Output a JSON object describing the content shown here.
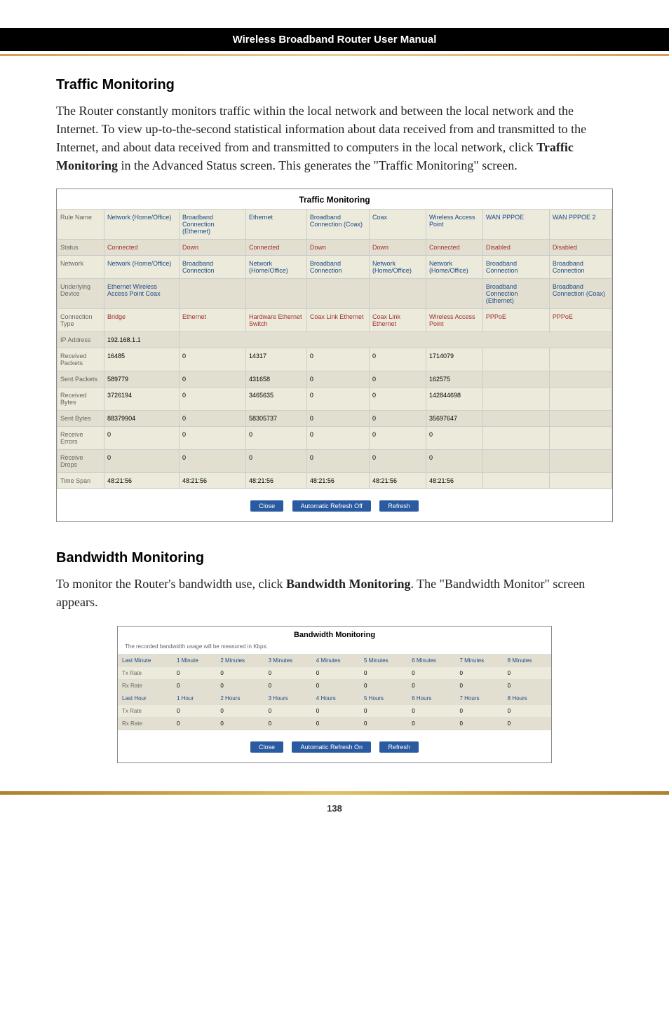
{
  "header": {
    "title": "Wireless Broadband Router User Manual"
  },
  "section1": {
    "title": "Traffic Monitoring",
    "body": "The Router constantly monitors traffic within the local network and between the local network and the Internet. To view up-to-the-second statistical information about data received from and transmitted to the Internet, and about data received from and transmitted to computers in the local network, click ",
    "body_bold": "Traffic Monitoring",
    "body_after": " in the Advanced Status screen. This generates the \"Traffic Monitoring\" screen."
  },
  "tm": {
    "title": "Traffic Monitoring",
    "rows": {
      "rule_name": {
        "label": "Rule Name",
        "c1": "Network (Home/Office)",
        "c2": "Broadband Connection (Ethernet)",
        "c3": "Ethernet",
        "c4": "Broadband Connection (Coax)",
        "c5": "Coax",
        "c6": "Wireless Access Point",
        "c7": "WAN PPPOE",
        "c8": "WAN PPPOE 2"
      },
      "status": {
        "label": "Status",
        "c1": "Connected",
        "c2": "Down",
        "c3": "Connected",
        "c4": "Down",
        "c5": "Down",
        "c6": "Connected",
        "c7": "Disabled",
        "c8": "Disabled"
      },
      "network": {
        "label": "Network",
        "c1": "Network (Home/Office)",
        "c2": "Broadband Connection",
        "c3": "Network (Home/Office)",
        "c4": "Broadband Connection",
        "c5": "Network (Home/Office)",
        "c6": "Network (Home/Office)",
        "c7": "Broadband Connection",
        "c8": "Broadband Connection"
      },
      "underlying": {
        "label": "Underlying Device",
        "c1": "Ethernet Wireless Access Point Coax",
        "c7": "Broadband Connection (Ethernet)",
        "c8": "Broadband Connection (Coax)"
      },
      "conn_type": {
        "label": "Connection Type",
        "c1": "Bridge",
        "c2": "Ethernet",
        "c3": "Hardware Ethernet Switch",
        "c4": "Coax Link Ethernet",
        "c5": "Coax Link Ethernet",
        "c6": "Wireless Access Point",
        "c7": "PPPoE",
        "c8": "PPPoE"
      },
      "ip": {
        "label": "IP Address",
        "c1": "192.168.1.1"
      },
      "rx_packets": {
        "label": "Received Packets",
        "c1": "16485",
        "c2": "0",
        "c3": "14317",
        "c4": "0",
        "c5": "0",
        "c6": "1714079"
      },
      "tx_packets": {
        "label": "Sent Packets",
        "c1": "589779",
        "c2": "0",
        "c3": "431658",
        "c4": "0",
        "c5": "0",
        "c6": "162575"
      },
      "rx_bytes": {
        "label": "Received Bytes",
        "c1": "3726194",
        "c2": "0",
        "c3": "3465635",
        "c4": "0",
        "c5": "0",
        "c6": "142844698"
      },
      "tx_bytes": {
        "label": "Sent Bytes",
        "c1": "88379904",
        "c2": "0",
        "c3": "58305737",
        "c4": "0",
        "c5": "0",
        "c6": "35697647"
      },
      "rx_errors": {
        "label": "Receive Errors",
        "c1": "0",
        "c2": "0",
        "c3": "0",
        "c4": "0",
        "c5": "0",
        "c6": "0"
      },
      "rx_drops": {
        "label": "Receive Drops",
        "c1": "0",
        "c2": "0",
        "c3": "0",
        "c4": "0",
        "c5": "0",
        "c6": "0"
      },
      "time_span": {
        "label": "Time Span",
        "c1": "48:21:56",
        "c2": "48:21:56",
        "c3": "48:21:56",
        "c4": "48:21:56",
        "c5": "48:21:56",
        "c6": "48:21:56"
      }
    },
    "buttons": {
      "close": "Close",
      "auto_refresh": "Automatic Refresh Off",
      "refresh": "Refresh"
    }
  },
  "section2": {
    "title": "Bandwidth Monitoring",
    "body": "To monitor the Router's bandwidth use, click ",
    "body_bold": "Bandwidth Monitoring",
    "body_after": ". The \"Bandwidth Monitor\" screen appears."
  },
  "bw": {
    "title": "Bandwidth Monitoring",
    "note": "The recorded bandwidth usage will be measured in Kbps:",
    "minute_header": {
      "label": "Last Minute",
      "c1": "1 Minute",
      "c2": "2 Minutes",
      "c3": "3 Minutes",
      "c4": "4 Minutes",
      "c5": "5 Minutes",
      "c6": "6 Minutes",
      "c7": "7 Minutes",
      "c8": "8 Minutes"
    },
    "tx_rate_min": {
      "label": "Tx Rate",
      "c1": "0",
      "c2": "0",
      "c3": "0",
      "c4": "0",
      "c5": "0",
      "c6": "0",
      "c7": "0",
      "c8": "0"
    },
    "rx_rate_min": {
      "label": "Rx Rate",
      "c1": "0",
      "c2": "0",
      "c3": "0",
      "c4": "0",
      "c5": "0",
      "c6": "0",
      "c7": "0",
      "c8": "0"
    },
    "hour_header": {
      "label": "Last Hour",
      "c1": "1 Hour",
      "c2": "2 Hours",
      "c3": "3 Hours",
      "c4": "4 Hours",
      "c5": "5 Hours",
      "c6": "6 Hours",
      "c7": "7 Hours",
      "c8": "8 Hours"
    },
    "tx_rate_hr": {
      "label": "Tx Rate",
      "c1": "0",
      "c2": "0",
      "c3": "0",
      "c4": "0",
      "c5": "0",
      "c6": "0",
      "c7": "0",
      "c8": "0"
    },
    "rx_rate_hr": {
      "label": "Rx Rate",
      "c1": "0",
      "c2": "0",
      "c3": "0",
      "c4": "0",
      "c5": "0",
      "c6": "0",
      "c7": "0",
      "c8": "0"
    },
    "buttons": {
      "close": "Close",
      "auto_refresh": "Automatic Refresh On",
      "refresh": "Refresh"
    }
  },
  "page_number": "138"
}
